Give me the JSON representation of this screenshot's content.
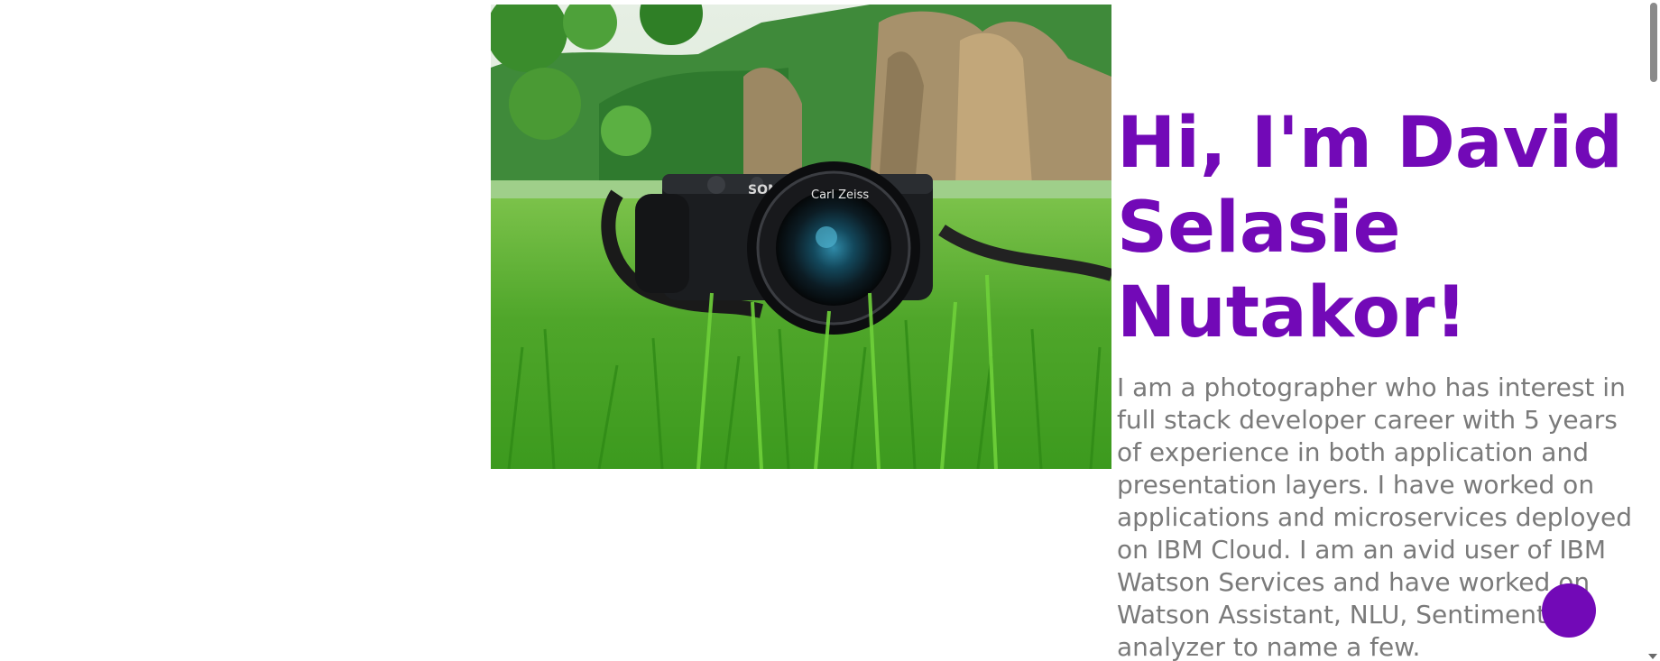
{
  "hero": {
    "image_alt": "Mirrorless camera with Carl Zeiss lens sitting in green grass",
    "lens_text": "Carl Zeiss",
    "brand_text": "SONY"
  },
  "intro": {
    "heading": "Hi, I'm David Selasie Nutakor!",
    "bio": "I am a photographer who has interest in full stack developer career with 5 years of experience in both application and presentation layers. I have worked on applications and microservices deployed on IBM Cloud. I am an avid user of IBM Watson Services and have worked on Watson Assistant, NLU, Sentiment analyzer to name a few."
  },
  "colors": {
    "accent": "#7209b7",
    "body_text": "#7a7a7a",
    "background": "#ffffff"
  },
  "icons": {
    "fab": "circle-action-button",
    "scroll_down": "chevron-down-icon"
  }
}
